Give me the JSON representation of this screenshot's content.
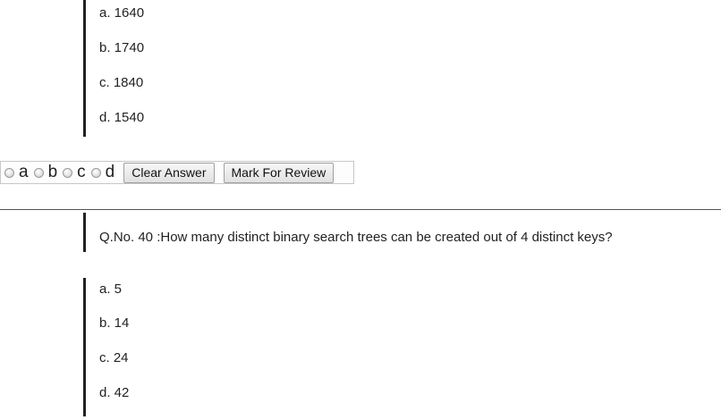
{
  "previous_question": {
    "options": [
      "a. 1640",
      "b. 1740",
      "c. 1840",
      "d. 1540"
    ]
  },
  "answer_bar": {
    "radios": [
      {
        "letter": "a",
        "icon": "radio-unselected"
      },
      {
        "letter": "b",
        "icon": "radio-unselected"
      },
      {
        "letter": "c",
        "icon": "radio-unselected"
      },
      {
        "letter": "d",
        "icon": "radio-unselected"
      }
    ],
    "clear_label": "Clear Answer",
    "review_label": "Mark For Review"
  },
  "current_question": {
    "text": "Q.No. 40 :How many distinct binary search trees can be created out of 4 distinct keys?",
    "options": [
      "a. 5",
      "b. 14",
      "c. 24",
      "d.  42"
    ]
  }
}
